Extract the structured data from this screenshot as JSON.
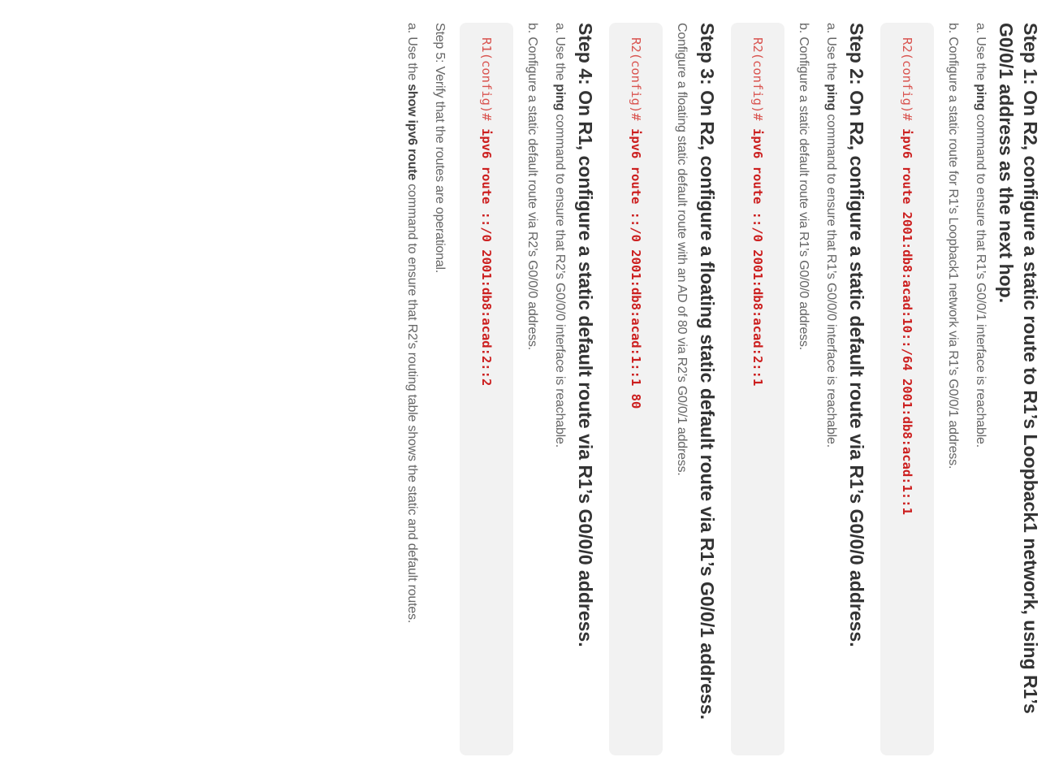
{
  "steps": [
    {
      "heading": "Step 1: On R2, configure a static route to R1’s Loopback1 network, using R1’s G0/0/1 address as the next hop.",
      "a": {
        "prefix": "a. Use the ",
        "bold": "ping",
        "suffix": " command to ensure that R1’s G0/0/1 interface is reachable."
      },
      "b": "b. Configure a static route for R1’s Loopback1 network via R1’s G0/0/1 address.",
      "code": {
        "prompt": "R2(config)#",
        "command": "ipv6 route 2001:db8:acad:10::/64 2001:db8:acad:1::1"
      }
    },
    {
      "heading": "Step 2: On R2, configure a static default route via R1’s G0/0/0 address.",
      "a": {
        "prefix": "a. Use the ",
        "bold": "ping",
        "suffix": " command to ensure that R1’s G0/0/0 interface is reachable."
      },
      "b": "b. Configure a static default route via R1’s G0/0/0 address.",
      "code": {
        "prompt": "R2(config)#",
        "command": "ipv6 route ::/0 2001:db8:acad:2::1"
      }
    },
    {
      "heading": "Step 3: On R2, configure a floating static default route via R1’s G0/0/1 address.",
      "text": "Configure a floating static default route with an AD of 80 via R2’s G0/0/1 address.",
      "code": {
        "prompt": "R2(config)#",
        "command": "ipv6 route ::/0 2001:db8:acad:1::1 80"
      }
    },
    {
      "heading": "Step 4: On R1, configure a static default route via R1’s G0/0/0 address.",
      "a": {
        "prefix": "a. Use the ",
        "bold": "ping",
        "suffix": " command to ensure that R2’s G0/0/0 interface is reachable."
      },
      "b": "b. Configure a static default route via R2’s G0/0/0 address.",
      "code": {
        "prompt": "R1(config)#",
        "command": "ipv6 route ::/0 2001:db8:acad:2::2"
      }
    },
    {
      "heading": "Step 5: Verify that the routes are operational.",
      "a": {
        "prefix": "a. Use the ",
        "bold": "show ipv6 route",
        "suffix": " command to ensure that R2’s routing table shows the static and default routes."
      }
    }
  ]
}
